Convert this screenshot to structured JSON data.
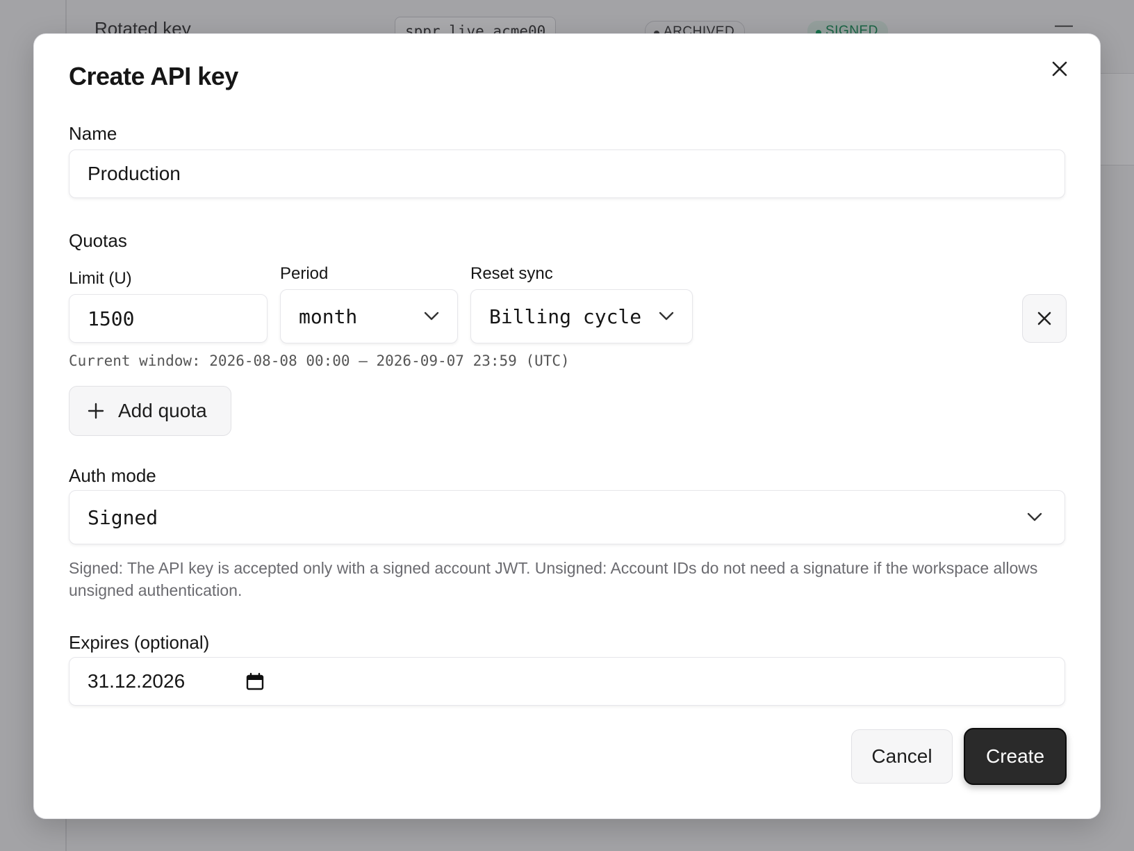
{
  "background": {
    "row_name": "Rotated key",
    "key_value": "sppr_live_acme00",
    "badge_archived": "ARCHIVED",
    "badge_signed": "SIGNED",
    "menu": "—"
  },
  "modal": {
    "title": "Create API key",
    "name_label": "Name",
    "name_value": "Production",
    "quotas_heading": "Quotas",
    "quota": {
      "limit_label": "Limit (U)",
      "limit_value": "1500",
      "period_label": "Period",
      "period_value": "month",
      "reset_label": "Reset sync",
      "reset_value": "Billing cycle",
      "window_text": "Current window: 2026-08-08 00:00 – 2026-09-07 23:59 (UTC)"
    },
    "add_quota_label": "Add quota",
    "auth_label": "Auth mode",
    "auth_value": "Signed",
    "auth_hint": "Signed: The API key is accepted only with a signed account JWT. Unsigned: Account IDs do not need a signature if the workspace allows unsigned authentication.",
    "expires_label": "Expires (optional)",
    "expires_value": "31.12.2026",
    "cancel_label": "Cancel",
    "create_label": "Create"
  }
}
